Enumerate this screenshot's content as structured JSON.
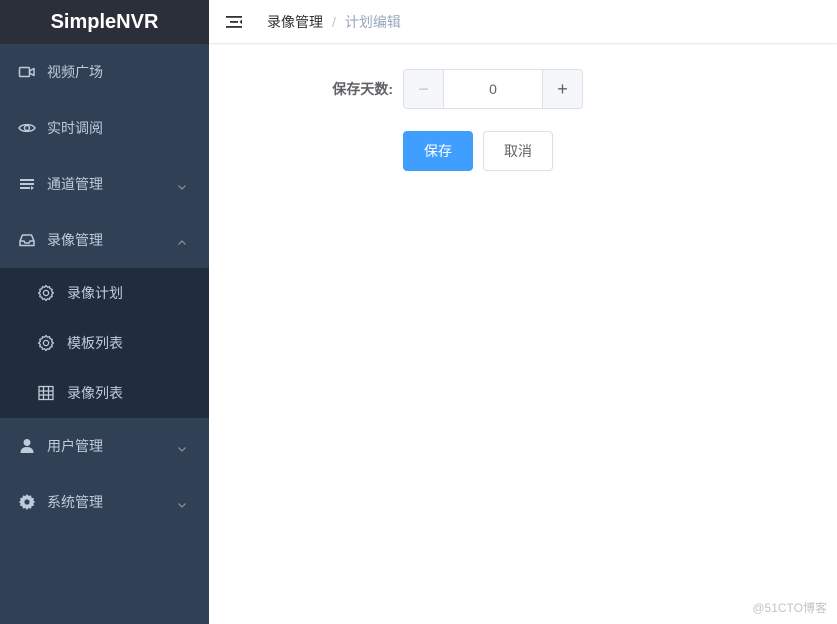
{
  "brand": {
    "title": "SimpleNVR"
  },
  "sidebar": {
    "items": [
      {
        "label": "视频广场",
        "icon": "video-camera-icon"
      },
      {
        "label": "实时调阅",
        "icon": "eye-icon"
      },
      {
        "label": "通道管理",
        "icon": "list-icon",
        "expandable": true
      },
      {
        "label": "录像管理",
        "icon": "inbox-icon",
        "expandable": true,
        "expanded": true,
        "children": [
          {
            "label": "录像计划",
            "icon": "gear-outline-icon"
          },
          {
            "label": "模板列表",
            "icon": "gear-outline-icon"
          },
          {
            "label": "录像列表",
            "icon": "grid-icon"
          }
        ]
      },
      {
        "label": "用户管理",
        "icon": "user-icon",
        "expandable": true
      },
      {
        "label": "系统管理",
        "icon": "gear-icon",
        "expandable": true
      }
    ]
  },
  "header": {
    "breadcrumb": {
      "parent": "录像管理",
      "separator": "/",
      "current": "计划编辑"
    }
  },
  "form": {
    "days_label": "保存天数:",
    "days_value": "0",
    "minus_label": "−",
    "plus_label": "+",
    "save_label": "保存",
    "cancel_label": "取消"
  },
  "footer": {
    "watermark": "@51CTO博客"
  },
  "colors": {
    "sidebar_bg": "#304156",
    "sidebar_active_bg": "#1f2d3d",
    "brand_bg": "#2b2f3a",
    "primary": "#409eff",
    "menu_text": "#bfcbd9"
  }
}
